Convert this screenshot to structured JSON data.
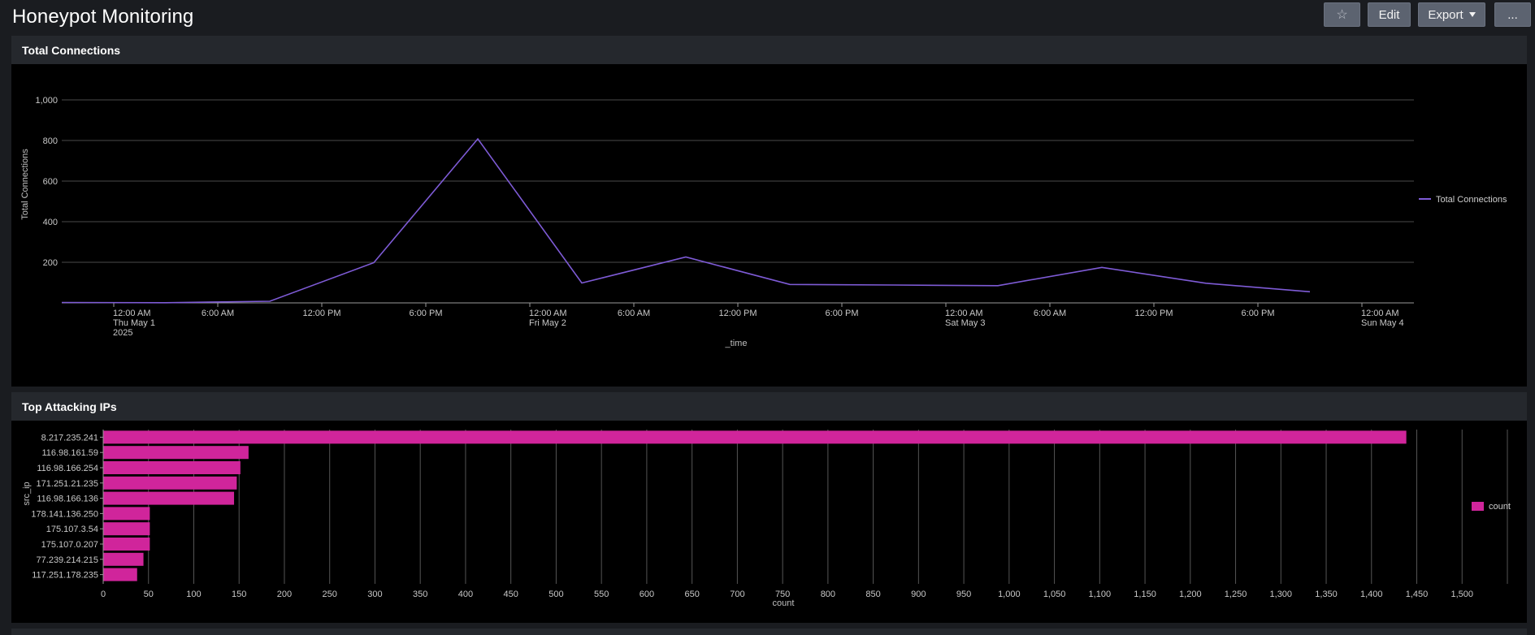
{
  "page": {
    "title": "Honeypot Monitoring"
  },
  "toolbar": {
    "star_icon": "☆",
    "edit_label": "Edit",
    "export_label": "Export",
    "more_label": "..."
  },
  "colors": {
    "background": "#1a1c20",
    "panel_header": "#25282d",
    "line_series": "#7e5bd6",
    "bar_series": "#d0259b"
  },
  "panels": [
    {
      "title": "Total Connections"
    },
    {
      "title": "Top Attacking IPs"
    }
  ],
  "chart_data": [
    {
      "type": "line",
      "ylabel": "Total Connections",
      "xlabel": "_time",
      "ylim": [
        0,
        1000
      ],
      "y_ticks": [
        "200",
        "400",
        "600",
        "800",
        "1,000"
      ],
      "y_tick_values": [
        200,
        400,
        600,
        800,
        1000
      ],
      "x_range": [
        "2025-04-30T21:00",
        "2025-05-04T03:00"
      ],
      "x_ticks": [
        {
          "t": "2025-05-01T00:00",
          "lines": [
            "12:00 AM",
            "Thu May 1",
            "2025"
          ]
        },
        {
          "t": "2025-05-01T06:00",
          "lines": [
            "6:00 AM"
          ]
        },
        {
          "t": "2025-05-01T12:00",
          "lines": [
            "12:00 PM"
          ]
        },
        {
          "t": "2025-05-01T18:00",
          "lines": [
            "6:00 PM"
          ]
        },
        {
          "t": "2025-05-02T00:00",
          "lines": [
            "12:00 AM",
            "Fri May 2"
          ]
        },
        {
          "t": "2025-05-02T06:00",
          "lines": [
            "6:00 AM"
          ]
        },
        {
          "t": "2025-05-02T12:00",
          "lines": [
            "12:00 PM"
          ]
        },
        {
          "t": "2025-05-02T18:00",
          "lines": [
            "6:00 PM"
          ]
        },
        {
          "t": "2025-05-03T00:00",
          "lines": [
            "12:00 AM",
            "Sat May 3"
          ]
        },
        {
          "t": "2025-05-03T06:00",
          "lines": [
            "6:00 AM"
          ]
        },
        {
          "t": "2025-05-03T12:00",
          "lines": [
            "12:00 PM"
          ]
        },
        {
          "t": "2025-05-03T18:00",
          "lines": [
            "6:00 PM"
          ]
        },
        {
          "t": "2025-05-04T00:00",
          "lines": [
            "12:00 AM",
            "Sun May 4"
          ]
        }
      ],
      "series": [
        {
          "name": "Total Connections",
          "x": [
            "2025-04-30T21:00",
            "2025-05-01T03:00",
            "2025-05-01T09:00",
            "2025-05-01T15:00",
            "2025-05-01T21:00",
            "2025-05-02T03:00",
            "2025-05-02T09:00",
            "2025-05-02T15:00",
            "2025-05-02T21:00",
            "2025-05-03T03:00",
            "2025-05-03T09:00",
            "2025-05-03T15:00",
            "2025-05-03T21:00"
          ],
          "values": [
            2,
            1,
            8,
            198,
            808,
            98,
            226,
            91,
            88,
            85,
            175,
            97,
            55
          ]
        }
      ],
      "legend": "right",
      "grid": true
    },
    {
      "type": "bar",
      "orientation": "horizontal",
      "ylabel": "src_ip",
      "xlabel": "count",
      "xlim": [
        0,
        1550
      ],
      "x_ticks": [
        "0",
        "50",
        "100",
        "150",
        "200",
        "250",
        "300",
        "350",
        "400",
        "450",
        "500",
        "550",
        "600",
        "650",
        "700",
        "750",
        "800",
        "850",
        "900",
        "950",
        "1,000",
        "1,050",
        "1,100",
        "1,150",
        "1,200",
        "1,250",
        "1,300",
        "1,350",
        "1,400",
        "1,450",
        "1,500"
      ],
      "x_tick_values": [
        0,
        50,
        100,
        150,
        200,
        250,
        300,
        350,
        400,
        450,
        500,
        550,
        600,
        650,
        700,
        750,
        800,
        850,
        900,
        950,
        1000,
        1050,
        1100,
        1150,
        1200,
        1250,
        1300,
        1350,
        1400,
        1450,
        1500
      ],
      "categories": [
        "8.217.235.241",
        "116.98.161.59",
        "116.98.166.254",
        "171.251.21.235",
        "116.98.166.136",
        "178.141.136.250",
        "175.107.3.54",
        "175.107.0.207",
        "77.239.214.215",
        "117.251.178.235"
      ],
      "series": [
        {
          "name": "count",
          "values": [
            1438,
            160,
            151,
            147,
            144,
            51,
            51,
            51,
            44,
            37
          ]
        }
      ],
      "legend": "right",
      "grid": true
    }
  ]
}
